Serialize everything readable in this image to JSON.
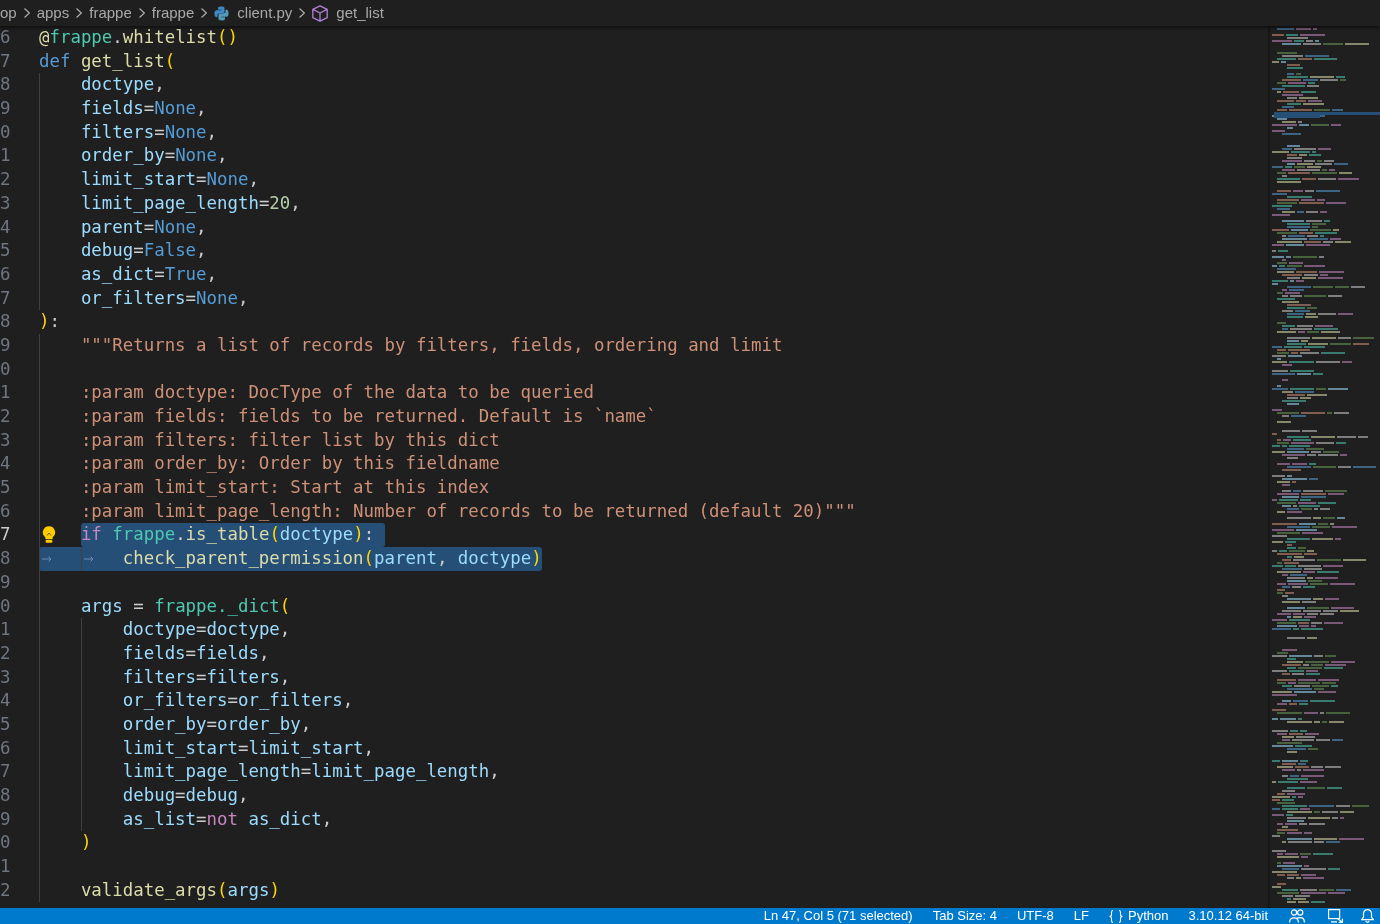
{
  "breadcrumbs": [
    {
      "label": "op",
      "kind": "folder"
    },
    {
      "label": "apps",
      "kind": "folder"
    },
    {
      "label": "frappe",
      "kind": "folder"
    },
    {
      "label": "frappe",
      "kind": "folder"
    },
    {
      "label": "client.py",
      "kind": "file"
    },
    {
      "label": "get_list",
      "kind": "symbol"
    }
  ],
  "editor": {
    "lines": [
      {
        "number": "6",
        "selected": false,
        "current": false,
        "tokens": [
          {
            "text": "@",
            "kind": "function"
          },
          {
            "text": "frappe",
            "kind": "class"
          },
          {
            "text": ".",
            "kind": "punct"
          },
          {
            "text": "whitelist",
            "kind": "function"
          },
          {
            "text": "()",
            "kind": "bracket"
          }
        ]
      },
      {
        "number": "7",
        "selected": false,
        "current": false,
        "tokens": [
          {
            "text": "def ",
            "kind": "keyword"
          },
          {
            "text": "get_list",
            "kind": "function"
          },
          {
            "text": "(",
            "kind": "bracket"
          }
        ]
      },
      {
        "number": "8",
        "selected": false,
        "current": false,
        "tokens": [
          {
            "text": "\tdoctype",
            "kind": "variable"
          },
          {
            "text": ",",
            "kind": "punct"
          }
        ]
      },
      {
        "number": "9",
        "selected": false,
        "current": false,
        "tokens": [
          {
            "text": "\tfields",
            "kind": "variable"
          },
          {
            "text": "=",
            "kind": "punct"
          },
          {
            "text": "None",
            "kind": "constant"
          },
          {
            "text": ",",
            "kind": "punct"
          }
        ]
      },
      {
        "number": "0",
        "selected": false,
        "current": false,
        "tokens": [
          {
            "text": "\tfilters",
            "kind": "variable"
          },
          {
            "text": "=",
            "kind": "punct"
          },
          {
            "text": "None",
            "kind": "constant"
          },
          {
            "text": ",",
            "kind": "punct"
          }
        ]
      },
      {
        "number": "1",
        "selected": false,
        "current": false,
        "tokens": [
          {
            "text": "\torder_by",
            "kind": "variable"
          },
          {
            "text": "=",
            "kind": "punct"
          },
          {
            "text": "None",
            "kind": "constant"
          },
          {
            "text": ",",
            "kind": "punct"
          }
        ]
      },
      {
        "number": "2",
        "selected": false,
        "current": false,
        "tokens": [
          {
            "text": "\tlimit_start",
            "kind": "variable"
          },
          {
            "text": "=",
            "kind": "punct"
          },
          {
            "text": "None",
            "kind": "constant"
          },
          {
            "text": ",",
            "kind": "punct"
          }
        ]
      },
      {
        "number": "3",
        "selected": false,
        "current": false,
        "tokens": [
          {
            "text": "\tlimit_page_length",
            "kind": "variable"
          },
          {
            "text": "=",
            "kind": "punct"
          },
          {
            "text": "20",
            "kind": "number"
          },
          {
            "text": ",",
            "kind": "punct"
          }
        ]
      },
      {
        "number": "4",
        "selected": false,
        "current": false,
        "tokens": [
          {
            "text": "\tparent",
            "kind": "variable"
          },
          {
            "text": "=",
            "kind": "punct"
          },
          {
            "text": "None",
            "kind": "constant"
          },
          {
            "text": ",",
            "kind": "punct"
          }
        ]
      },
      {
        "number": "5",
        "selected": false,
        "current": false,
        "tokens": [
          {
            "text": "\tdebug",
            "kind": "variable"
          },
          {
            "text": "=",
            "kind": "punct"
          },
          {
            "text": "False",
            "kind": "constant"
          },
          {
            "text": ",",
            "kind": "punct"
          }
        ]
      },
      {
        "number": "6",
        "selected": false,
        "current": false,
        "tokens": [
          {
            "text": "\tas_dict",
            "kind": "variable"
          },
          {
            "text": "=",
            "kind": "punct"
          },
          {
            "text": "True",
            "kind": "constant"
          },
          {
            "text": ",",
            "kind": "punct"
          }
        ]
      },
      {
        "number": "7",
        "selected": false,
        "current": false,
        "tokens": [
          {
            "text": "\tor_filters",
            "kind": "variable"
          },
          {
            "text": "=",
            "kind": "punct"
          },
          {
            "text": "None",
            "kind": "constant"
          },
          {
            "text": ",",
            "kind": "punct"
          }
        ]
      },
      {
        "number": "8",
        "selected": false,
        "current": false,
        "tokens": [
          {
            "text": ")",
            "kind": "bracket"
          },
          {
            "text": ":",
            "kind": "punct"
          }
        ]
      },
      {
        "number": "9",
        "selected": false,
        "current": false,
        "tokens": [
          {
            "text": "\t\"\"\"Returns a list of records by filters, fields, ordering and limit",
            "kind": "string"
          }
        ]
      },
      {
        "number": "0",
        "selected": false,
        "current": false
      },
      {
        "number": "1",
        "selected": false,
        "current": false,
        "tokens": [
          {
            "text": "\t:param doctype: DocType of the data to be queried",
            "kind": "string"
          }
        ]
      },
      {
        "number": "2",
        "selected": false,
        "current": false,
        "tokens": [
          {
            "text": "\t:param fields: fields to be returned. Default is `name`",
            "kind": "string"
          }
        ]
      },
      {
        "number": "3",
        "selected": false,
        "current": false,
        "tokens": [
          {
            "text": "\t:param filters: filter list by this dict",
            "kind": "string"
          }
        ]
      },
      {
        "number": "4",
        "selected": false,
        "current": false,
        "tokens": [
          {
            "text": "\t:param order_by: Order by this fieldname",
            "kind": "string"
          }
        ]
      },
      {
        "number": "5",
        "selected": false,
        "current": false,
        "tokens": [
          {
            "text": "\t:param limit_start: Start at this index",
            "kind": "string"
          }
        ]
      },
      {
        "number": "6",
        "selected": false,
        "current": false,
        "tokens": [
          {
            "text": "\t:param limit_page_length: Number of records to be returned (default 20)\"\"\"",
            "kind": "string"
          }
        ]
      },
      {
        "number": "7",
        "selected": true,
        "current": true,
        "tokens": [
          {
            "text": "\tif ",
            "kind": "control"
          },
          {
            "text": "frappe",
            "kind": "class"
          },
          {
            "text": ".",
            "kind": "punct"
          },
          {
            "text": "is_table",
            "kind": "function"
          },
          {
            "text": "(",
            "kind": "bracket"
          },
          {
            "text": "doctype",
            "kind": "variable"
          },
          {
            "text": ")",
            "kind": "bracket"
          },
          {
            "text": ":",
            "kind": "punct"
          }
        ]
      },
      {
        "number": "8",
        "selected": true,
        "current": false,
        "tokens": [
          {
            "text": "\t\tcheck_parent_permission",
            "kind": "function"
          },
          {
            "text": "(",
            "kind": "bracket"
          },
          {
            "text": "parent",
            "kind": "variable"
          },
          {
            "text": ", ",
            "kind": "punct"
          },
          {
            "text": "doctype",
            "kind": "variable"
          },
          {
            "text": ")",
            "kind": "bracket"
          }
        ]
      },
      {
        "number": "9",
        "selected": false,
        "current": false
      },
      {
        "number": "0",
        "selected": false,
        "current": false,
        "tokens": [
          {
            "text": "\targs",
            "kind": "variable"
          },
          {
            "text": " = ",
            "kind": "punct"
          },
          {
            "text": "frappe._dict",
            "kind": "class"
          },
          {
            "text": "(",
            "kind": "bracket"
          }
        ]
      },
      {
        "number": "1",
        "selected": false,
        "current": false,
        "tokens": [
          {
            "text": "\t\tdoctype",
            "kind": "variable"
          },
          {
            "text": "=",
            "kind": "punct"
          },
          {
            "text": "doctype",
            "kind": "variable"
          },
          {
            "text": ",",
            "kind": "punct"
          }
        ]
      },
      {
        "number": "2",
        "selected": false,
        "current": false,
        "tokens": [
          {
            "text": "\t\tfields",
            "kind": "variable"
          },
          {
            "text": "=",
            "kind": "punct"
          },
          {
            "text": "fields",
            "kind": "variable"
          },
          {
            "text": ",",
            "kind": "punct"
          }
        ]
      },
      {
        "number": "3",
        "selected": false,
        "current": false,
        "tokens": [
          {
            "text": "\t\tfilters",
            "kind": "variable"
          },
          {
            "text": "=",
            "kind": "punct"
          },
          {
            "text": "filters",
            "kind": "variable"
          },
          {
            "text": ",",
            "kind": "punct"
          }
        ]
      },
      {
        "number": "4",
        "selected": false,
        "current": false,
        "tokens": [
          {
            "text": "\t\tor_filters",
            "kind": "variable"
          },
          {
            "text": "=",
            "kind": "punct"
          },
          {
            "text": "or_filters",
            "kind": "variable"
          },
          {
            "text": ",",
            "kind": "punct"
          }
        ]
      },
      {
        "number": "5",
        "selected": false,
        "current": false,
        "tokens": [
          {
            "text": "\t\torder_by",
            "kind": "variable"
          },
          {
            "text": "=",
            "kind": "punct"
          },
          {
            "text": "order_by",
            "kind": "variable"
          },
          {
            "text": ",",
            "kind": "punct"
          }
        ]
      },
      {
        "number": "6",
        "selected": false,
        "current": false,
        "tokens": [
          {
            "text": "\t\tlimit_start",
            "kind": "variable"
          },
          {
            "text": "=",
            "kind": "punct"
          },
          {
            "text": "limit_start",
            "kind": "variable"
          },
          {
            "text": ",",
            "kind": "punct"
          }
        ]
      },
      {
        "number": "7",
        "selected": false,
        "current": false,
        "tokens": [
          {
            "text": "\t\tlimit_page_length",
            "kind": "variable"
          },
          {
            "text": "=",
            "kind": "punct"
          },
          {
            "text": "limit_page_length",
            "kind": "variable"
          },
          {
            "text": ",",
            "kind": "punct"
          }
        ]
      },
      {
        "number": "8",
        "selected": false,
        "current": false,
        "tokens": [
          {
            "text": "\t\tdebug",
            "kind": "variable"
          },
          {
            "text": "=",
            "kind": "punct"
          },
          {
            "text": "debug",
            "kind": "variable"
          },
          {
            "text": ",",
            "kind": "punct"
          }
        ]
      },
      {
        "number": "9",
        "selected": false,
        "current": false,
        "tokens": [
          {
            "text": "\t\tas_list",
            "kind": "variable"
          },
          {
            "text": "=",
            "kind": "punct"
          },
          {
            "text": "not ",
            "kind": "control"
          },
          {
            "text": "as_dict",
            "kind": "variable"
          },
          {
            "text": ",",
            "kind": "punct"
          }
        ]
      },
      {
        "number": "0",
        "selected": false,
        "current": false,
        "tokens": [
          {
            "text": "\t)",
            "kind": "bracket"
          }
        ]
      },
      {
        "number": "1",
        "selected": false,
        "current": false
      },
      {
        "number": "2",
        "selected": false,
        "current": false,
        "tokens": [
          {
            "text": "\tvalidate_args",
            "kind": "function"
          },
          {
            "text": "(",
            "kind": "bracket"
          },
          {
            "text": "args",
            "kind": "variable"
          },
          {
            "text": ")",
            "kind": "bracket"
          }
        ]
      }
    ]
  },
  "status_bar": {
    "items": [
      {
        "text": "Ln 47, Col 5 (71 selected)",
        "kind": "text"
      },
      {
        "text": "Tab Size: 4",
        "kind": "text"
      },
      {
        "text": "UTF-8",
        "kind": "text"
      },
      {
        "text": "LF",
        "kind": "text"
      },
      {
        "text": "Python",
        "kind": "language"
      },
      {
        "text": "3.10.12 64-bit",
        "kind": "text"
      }
    ]
  }
}
